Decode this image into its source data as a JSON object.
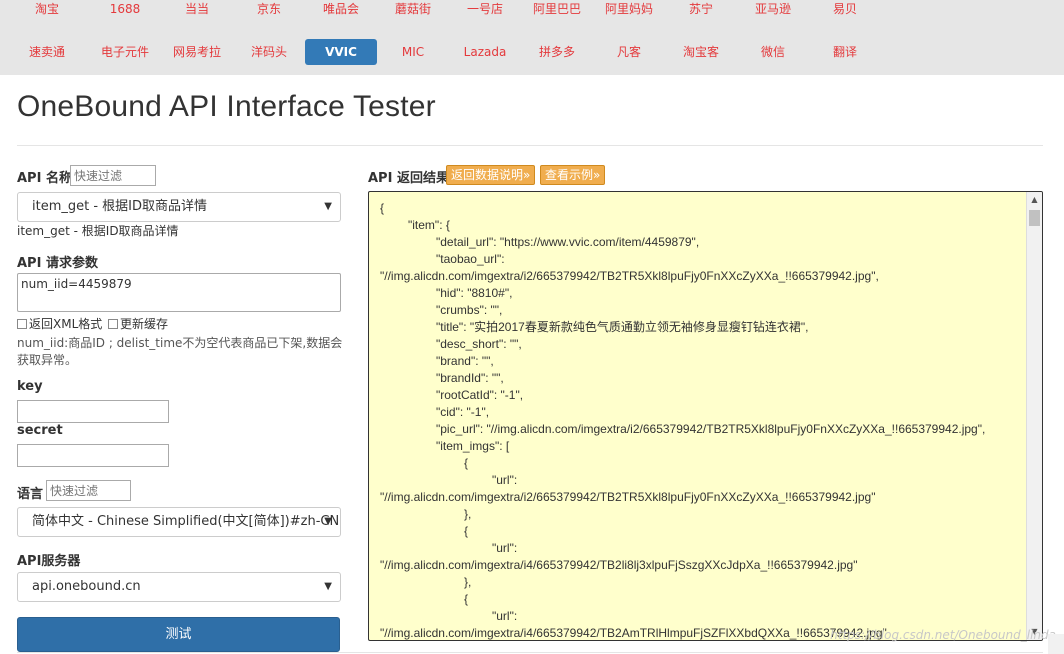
{
  "nav": {
    "row1": [
      "淘宝",
      "1688",
      "当当",
      "京东",
      "唯品会",
      "蘑菇街",
      "一号店",
      "阿里巴巴",
      "阿里妈妈",
      "苏宁",
      "亚马逊",
      "易贝"
    ],
    "row2": [
      "速卖通",
      "电子元件",
      "网易考拉",
      "洋码头",
      "VVIC",
      "MIC",
      "Lazada",
      "拼多多",
      "凡客",
      "淘宝客",
      "微信",
      "翻译"
    ],
    "active": "VVIC"
  },
  "page": {
    "title": "OneBound API Interface Tester"
  },
  "form": {
    "api_name_label": "API 名称",
    "api_filter_placeholder": "快速过滤",
    "api_selected": "item_get - 根据ID取商品详情",
    "api_desc": "item_get - 根据ID取商品详情",
    "params_label": "API 请求参数",
    "params_value": "num_iid=4459879",
    "xml_checkbox": "返回XML格式",
    "cache_checkbox": "更新缓存",
    "param_desc": "num_iid:商品ID ; delist_time不为空代表商品已下架,数据会获取异常。",
    "key_label": "key",
    "secret_label": "secret",
    "lang_label": "语言",
    "lang_filter_placeholder": "快速过滤",
    "lang_selected": "简体中文 - Chinese Simplified(中文[简体])#zh-CN",
    "server_label": "API服务器",
    "server_selected": "api.onebound.cn",
    "test_button": "测试"
  },
  "result": {
    "label": "API 返回结果",
    "doc_button": "返回数据说明»",
    "example_button": "查看示例»",
    "lines": [
      "{",
      "\t\"item\": {",
      "\t\t\"detail_url\": \"https://www.vvic.com/item/4459879\",",
      "\t\t\"taobao_url\":",
      "\"//img.alicdn.com/imgextra/i2/665379942/TB2TR5Xkl8lpuFjy0FnXXcZyXXa_!!665379942.jpg\",",
      "\t\t\"hid\": \"8810#\",",
      "\t\t\"crumbs\": \"\",",
      "\t\t\"title\": \"实拍2017春夏新款纯色气质通勤立领无袖修身显瘦钉钻连衣裙\",",
      "\t\t\"desc_short\": \"\",",
      "\t\t\"brand\": \"\",",
      "\t\t\"brandId\": \"\",",
      "\t\t\"rootCatId\": \"-1\",",
      "\t\t\"cid\": \"-1\",",
      "\t\t\"pic_url\": \"//img.alicdn.com/imgextra/i2/665379942/TB2TR5Xkl8lpuFjy0FnXXcZyXXa_!!665379942.jpg\",",
      "\t\t\"item_imgs\": [",
      "\t\t\t{",
      "\t\t\t\t\"url\":",
      "\"//img.alicdn.com/imgextra/i2/665379942/TB2TR5Xkl8lpuFjy0FnXXcZyXXa_!!665379942.jpg\"",
      "\t\t\t},",
      "\t\t\t{",
      "\t\t\t\t\"url\":",
      "\"//img.alicdn.com/imgextra/i4/665379942/TB2li8lj3xlpuFjSszgXXcJdpXa_!!665379942.jpg\"",
      "\t\t\t},",
      "\t\t\t{",
      "\t\t\t\t\"url\":",
      "\"//img.alicdn.com/imgextra/i4/665379942/TB2AmTRlHlmpuFjSZFlXXbdQXXa_!!665379942.jpg\""
    ],
    "watermark": "https://blog.csdn.net/Onebound_linda"
  }
}
